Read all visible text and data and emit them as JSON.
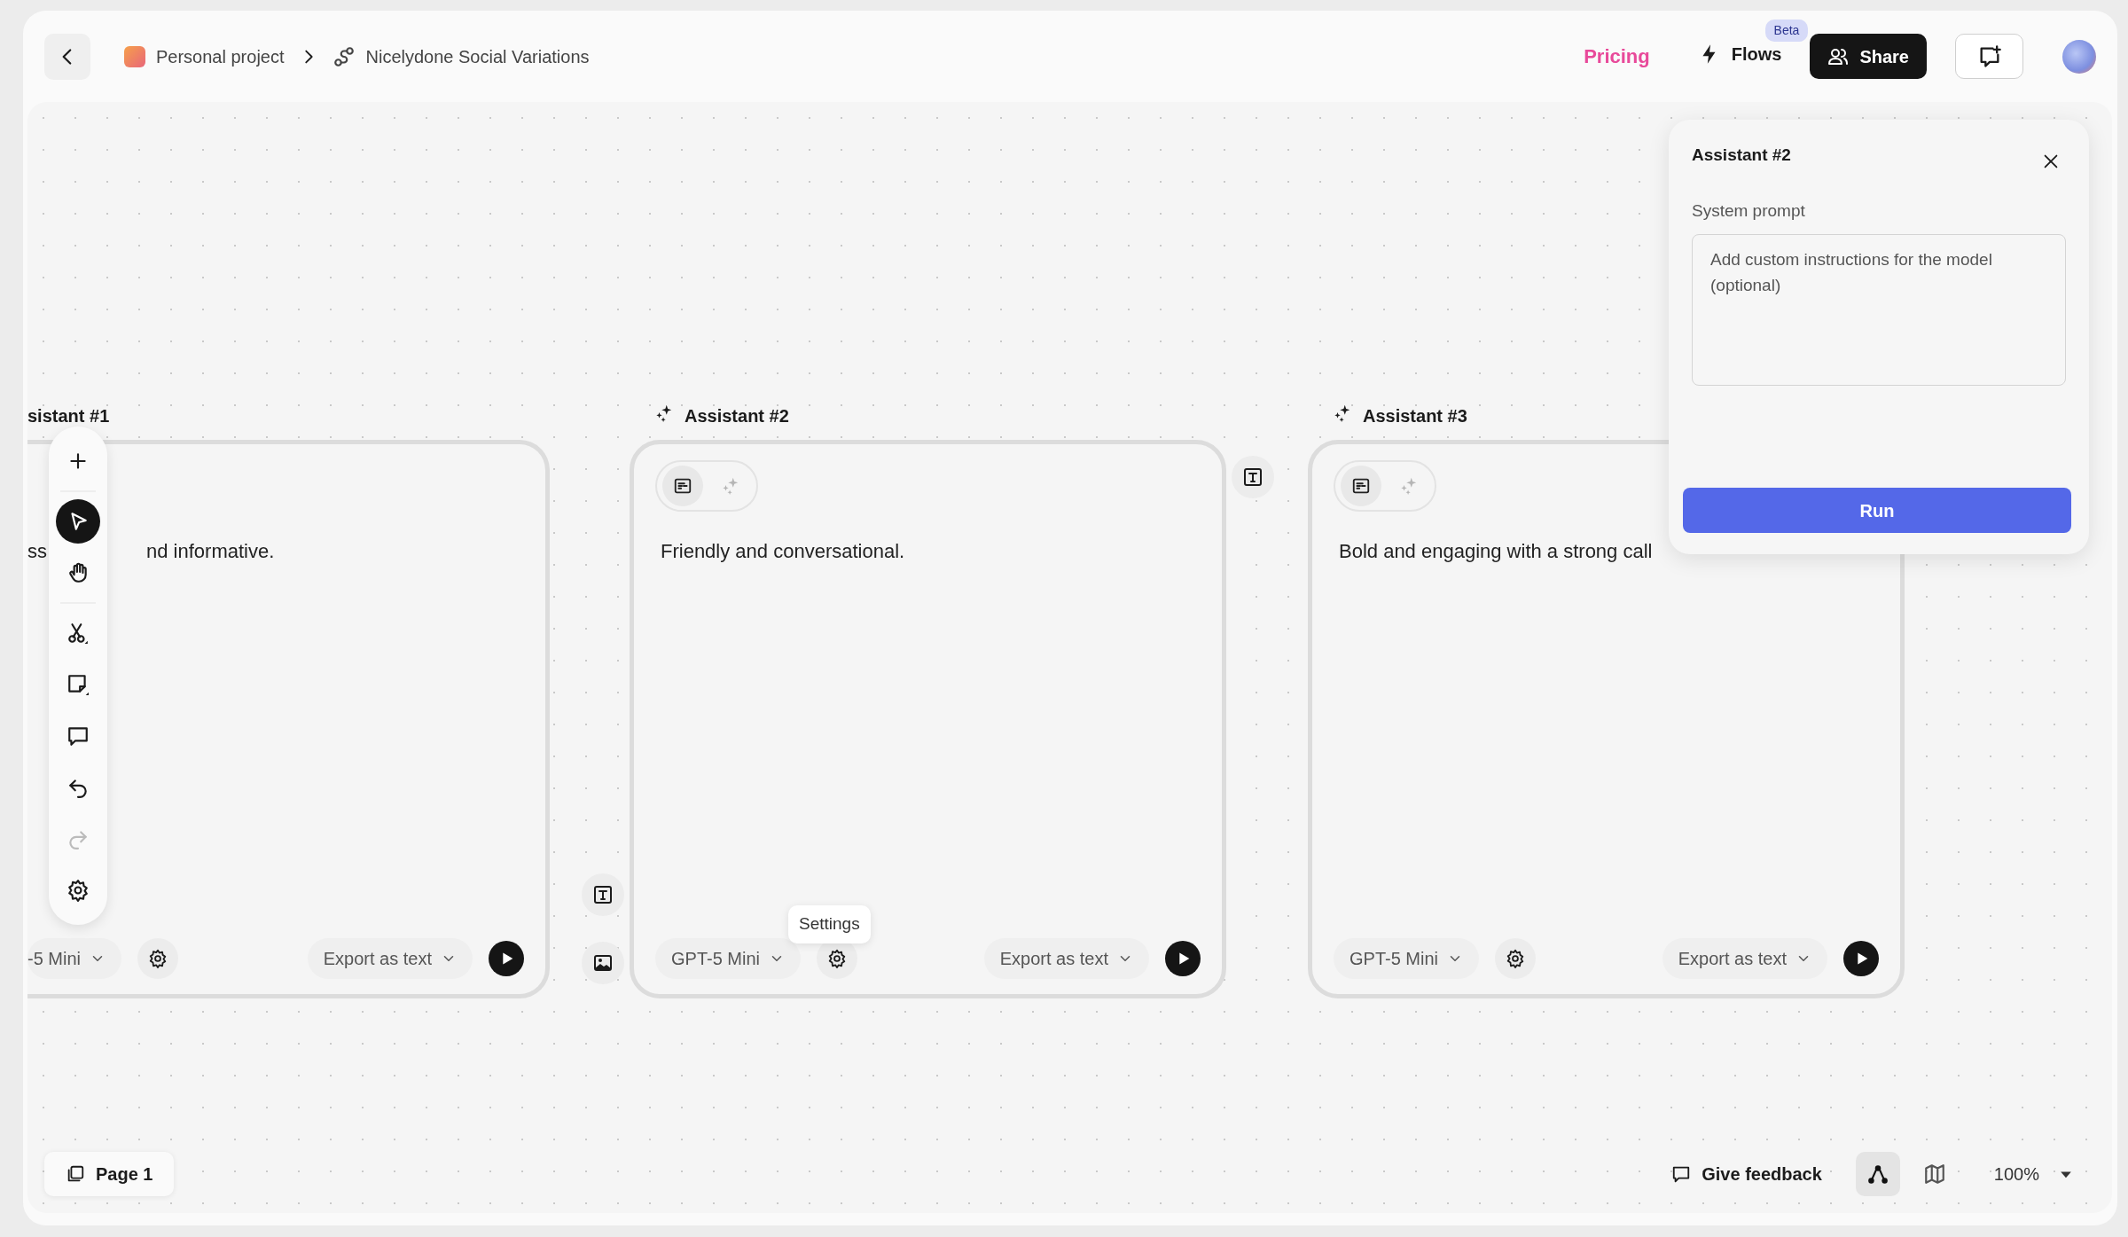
{
  "topbar": {
    "breadcrumb": [
      {
        "kind": "project",
        "label": "Personal project"
      },
      {
        "kind": "flow",
        "label": "Nicelydone Social Variations"
      }
    ],
    "pricing": "Pricing",
    "flows": {
      "label": "Flows",
      "badge": "Beta"
    },
    "share": "Share"
  },
  "toolbar": [
    {
      "kind": "add",
      "selected": false,
      "disabled": false
    },
    {
      "kind": "divider"
    },
    {
      "kind": "select",
      "selected": true,
      "disabled": false
    },
    {
      "kind": "hand",
      "selected": false,
      "disabled": false
    },
    {
      "kind": "divider"
    },
    {
      "kind": "cut",
      "selected": false,
      "disabled": false
    },
    {
      "kind": "sticky",
      "selected": false,
      "disabled": false
    },
    {
      "kind": "comment",
      "selected": false,
      "disabled": false
    },
    {
      "kind": "undo",
      "selected": false,
      "disabled": false
    },
    {
      "kind": "redo",
      "selected": false,
      "disabled": true
    },
    {
      "kind": "settings",
      "selected": false,
      "disabled": false
    }
  ],
  "nodes": [
    {
      "title": "sistant #1",
      "cut_left": true,
      "text_parts": [
        "ss",
        "nd informative."
      ],
      "model": "-5 Mini",
      "export": "Export as text"
    },
    {
      "title": "Assistant #2",
      "cut_left": false,
      "modes": [
        {
          "kind": "text",
          "selected": true
        },
        {
          "kind": "ai",
          "selected": false
        }
      ],
      "text_parts": [
        "Friendly and conversational."
      ],
      "model": "GPT-5 Mini",
      "export": "Export as text",
      "tooltip": "Settings"
    },
    {
      "title": "Assistant #3",
      "cut_left": false,
      "modes": [
        {
          "kind": "text",
          "selected": true
        },
        {
          "kind": "ai",
          "selected": false
        }
      ],
      "text_parts": [
        "Bold and engaging with a strong call"
      ],
      "model": "GPT-5 Mini",
      "export": "Export as text"
    }
  ],
  "side_tools": [
    {
      "kind": "text"
    },
    {
      "kind": "image"
    },
    {
      "kind": "text"
    }
  ],
  "panel": {
    "title": "Assistant #2",
    "label": "System prompt",
    "placeholder": "Add custom instructions for the model (optional)",
    "button": "Run"
  },
  "bottom": {
    "page": "Page 1",
    "feedback": "Give feedback",
    "view_modes": [
      {
        "kind": "flow",
        "selected": true
      },
      {
        "kind": "map",
        "selected": false
      }
    ],
    "zoom": "100%"
  }
}
